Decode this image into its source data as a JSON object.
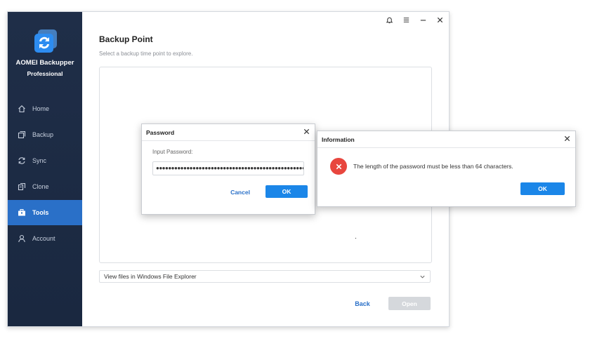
{
  "app": {
    "name": "AOMEI Backupper",
    "edition": "Professional",
    "colors": {
      "sidebar": "#1f2e48",
      "accent": "#2a70c8",
      "primary_button": "#1b86e8",
      "error": "#e8463e"
    }
  },
  "sidebar": {
    "items": [
      {
        "label": "Home",
        "icon": "home-icon",
        "active": false
      },
      {
        "label": "Backup",
        "icon": "backup-icon",
        "active": false
      },
      {
        "label": "Sync",
        "icon": "sync-icon",
        "active": false
      },
      {
        "label": "Clone",
        "icon": "clone-icon",
        "active": false
      },
      {
        "label": "Tools",
        "icon": "toolbox-icon",
        "active": true
      },
      {
        "label": "Account",
        "icon": "user-icon",
        "active": false
      }
    ]
  },
  "titlebar": {
    "icons": [
      "bell-icon",
      "menu-icon",
      "minimize-icon",
      "close-icon"
    ]
  },
  "main": {
    "title": "Backup Point",
    "subtitle": "Select a backup time point to explore.",
    "select_value": "View files in Windows File Explorer",
    "back_label": "Back",
    "open_label": "Open"
  },
  "password_dialog": {
    "title": "Password",
    "label": "Input Password:",
    "value": "●●●●●●●●●●●●●●●●●●●●●●●●●●●●●●●●●●●●●●●●●●●●●●●●●●●●",
    "cancel_label": "Cancel",
    "ok_label": "OK"
  },
  "info_dialog": {
    "title": "Information",
    "message": "The length of the password must be less than 64 characters.",
    "ok_label": "OK"
  }
}
